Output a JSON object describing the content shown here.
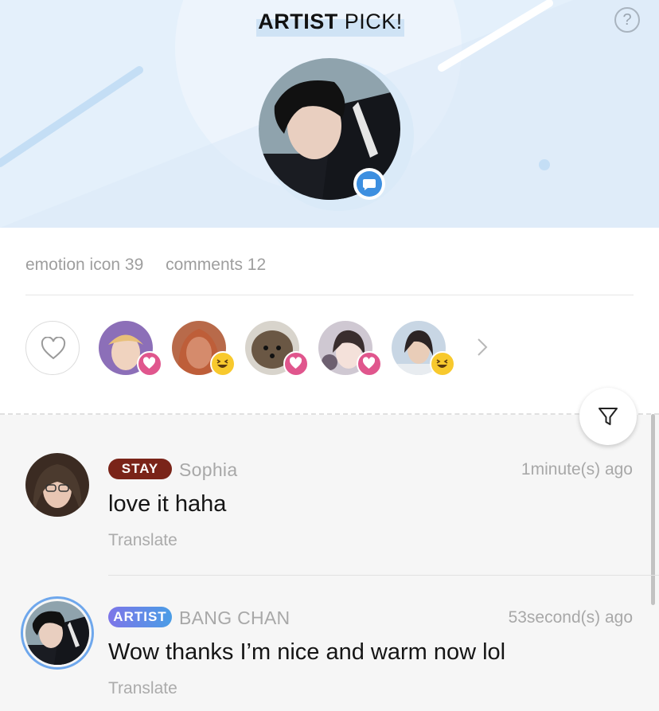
{
  "header": {
    "title_bold": "ARTIST",
    "title_rest": " PICK!",
    "help_label": "?",
    "accent_color": "#3d8fe0"
  },
  "stats": {
    "emotion_label": "emotion icon 39",
    "comments_label": "comments 12"
  },
  "reactions": [
    {
      "reaction": "heart-icon"
    },
    {
      "reaction": "laughing-emoji-icon"
    },
    {
      "reaction": "heart-icon"
    },
    {
      "reaction": "heart-icon"
    },
    {
      "reaction": "laughing-emoji-icon"
    }
  ],
  "comments": [
    {
      "badge": "STAY",
      "badge_color": "#7a2419",
      "author": "Sophia",
      "time": "1minute(s) ago",
      "text": "love it haha",
      "translate": "Translate"
    },
    {
      "badge": "ARTIST",
      "badge_color": "#5f83e6",
      "author": "BANG CHAN",
      "time": "53second(s) ago",
      "text": "Wow thanks I’m nice and warm now lol",
      "translate": "Translate"
    }
  ]
}
